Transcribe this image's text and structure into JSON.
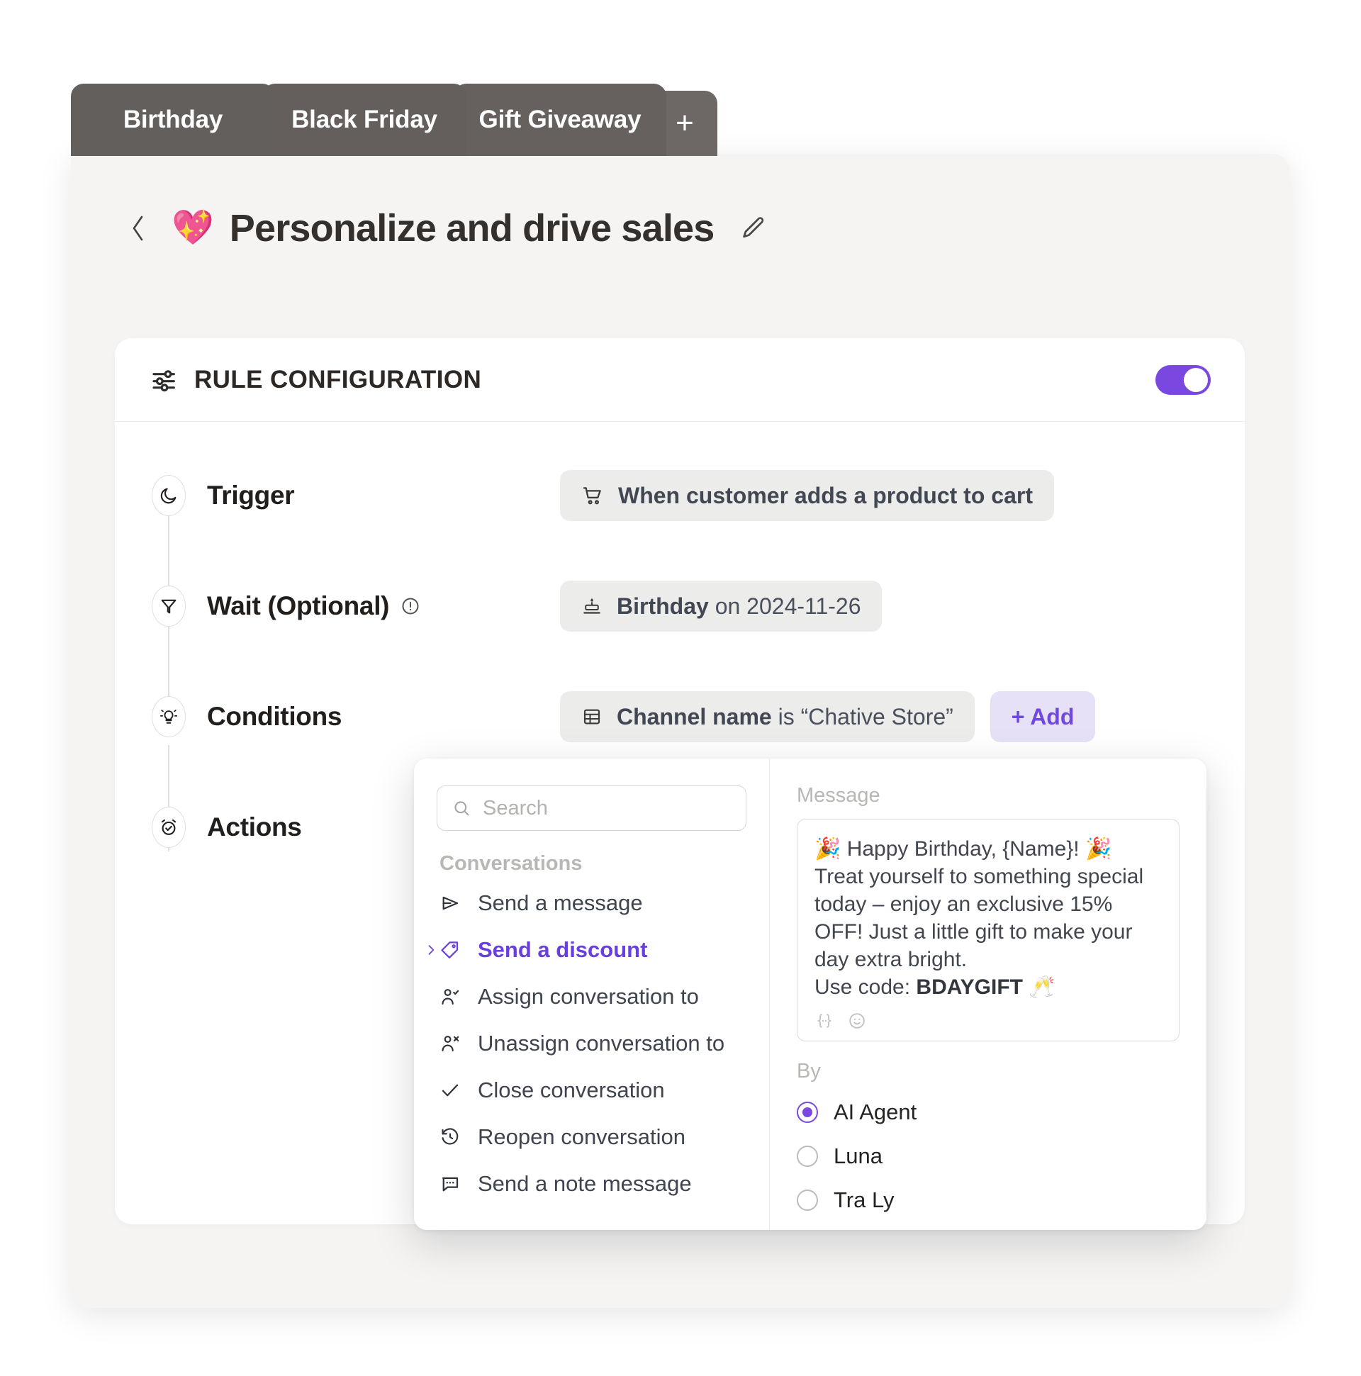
{
  "tabs": {
    "items": [
      {
        "label": "Birthday"
      },
      {
        "label": "Black Friday"
      },
      {
        "label": "Gift Giveaway"
      }
    ],
    "add_label": "+"
  },
  "header": {
    "back_label": "‹",
    "emoji": "💖",
    "title": "Personalize and drive sales"
  },
  "card": {
    "title": "RULE CONFIGURATION",
    "enabled": true
  },
  "rows": {
    "trigger": {
      "label": "Trigger",
      "chip_text": "When customer adds a product to cart"
    },
    "wait": {
      "label": "Wait (Optional)",
      "chip_bold": "Birthday",
      "chip_rest": " on 2024-11-26"
    },
    "conditions": {
      "label": "Conditions",
      "chip_bold": "Channel name",
      "chip_rest": " is “Chative Store”",
      "add_label": "+ Add"
    },
    "actions": {
      "label": "Actions"
    }
  },
  "popover": {
    "search": {
      "placeholder": "Search",
      "value": ""
    },
    "group_label": "Conversations",
    "menu": [
      {
        "label": "Send a message",
        "icon": "send-icon",
        "active": false
      },
      {
        "label": "Send a discount",
        "icon": "tag-icon",
        "active": true
      },
      {
        "label": "Assign conversation to",
        "icon": "user-check-icon",
        "active": false
      },
      {
        "label": "Unassign conversation to",
        "icon": "user-x-icon",
        "active": false
      },
      {
        "label": "Close conversation",
        "icon": "check-icon",
        "active": false
      },
      {
        "label": "Reopen conversation",
        "icon": "history-icon",
        "active": false
      },
      {
        "label": "Send a note message",
        "icon": "note-icon",
        "active": false
      }
    ],
    "message": {
      "label": "Message",
      "body_line1_pre": "🎉 Happy Birthday, {Name}! 🎉\nTreat yourself to something special today – enjoy an exclusive 15% OFF! Just a little gift to make your day extra bright.\nUse code: ",
      "body_code": "BDAYGIFT",
      "body_post": " 🥂"
    },
    "by": {
      "label": "By",
      "options": [
        {
          "label": "AI Agent",
          "selected": true
        },
        {
          "label": "Luna",
          "selected": false
        },
        {
          "label": "Tra Ly",
          "selected": false
        }
      ]
    }
  },
  "colors": {
    "accent": "#7a48e0",
    "accent_soft": "#e7e1f7",
    "chip_bg": "#ececeb",
    "tab_bg": "#625e5c"
  }
}
